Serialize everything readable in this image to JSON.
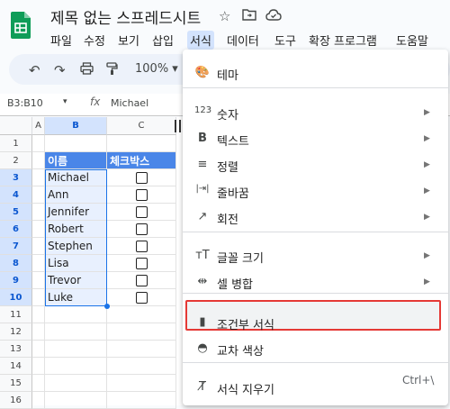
{
  "header": {
    "title": "제목 없는 스프레드시트",
    "icons": [
      "star-icon",
      "move-to-folder-icon",
      "cloud-status-icon"
    ]
  },
  "menubar": {
    "items": [
      "파일",
      "수정",
      "보기",
      "삽입",
      "서식",
      "데이터",
      "도구",
      "확장 프로그램",
      "도움말"
    ],
    "active": "서식"
  },
  "toolbar": {
    "icons": [
      "undo-icon",
      "redo-icon",
      "print-icon",
      "paint-format-icon"
    ],
    "zoom": "100%"
  },
  "formula_bar": {
    "name_box": "B3:B10",
    "fx": "fx",
    "value": "Michael"
  },
  "sheet": {
    "columns": [
      "A",
      "B",
      "C"
    ],
    "rows": [
      "1",
      "2",
      "3",
      "4",
      "5",
      "6",
      "7",
      "8",
      "9",
      "10",
      "11",
      "12",
      "13",
      "14",
      "15",
      "16"
    ],
    "header_row": {
      "b": "이름",
      "c": "체크박스"
    },
    "names": [
      "Michael",
      "Ann",
      "Jennifer",
      "Robert",
      "Stephen",
      "Lisa",
      "Trevor",
      "Luke"
    ]
  },
  "format_menu": {
    "items": [
      {
        "label": "테마",
        "icon": "palette-icon",
        "submenu": false
      },
      {
        "label": "숫자",
        "icon": "number-format-icon",
        "submenu": true
      },
      {
        "label": "텍스트",
        "icon": "bold-icon",
        "submenu": true
      },
      {
        "label": "정렬",
        "icon": "align-icon",
        "submenu": true
      },
      {
        "label": "줄바꿈",
        "icon": "text-wrap-icon",
        "submenu": true
      },
      {
        "label": "회전",
        "icon": "text-rotate-icon",
        "submenu": true
      },
      {
        "label": "글꼴 크기",
        "icon": "font-size-icon",
        "submenu": true
      },
      {
        "label": "셀 병합",
        "icon": "merge-cells-icon",
        "submenu": true
      },
      {
        "label": "조건부 서식",
        "icon": "conditional-format-icon",
        "submenu": false
      },
      {
        "label": "교차 색상",
        "icon": "alternating-colors-icon",
        "submenu": false
      },
      {
        "label": "서식 지우기",
        "icon": "clear-format-icon",
        "submenu": false
      }
    ],
    "clear_shortcut": "Ctrl+\\",
    "highlighted": "조건부 서식"
  },
  "colors": {
    "header_fill": "#4a86e8",
    "selection": "#1a73e8",
    "highlight_border": "#e53935",
    "menubar_active": "#d3e3fd"
  }
}
